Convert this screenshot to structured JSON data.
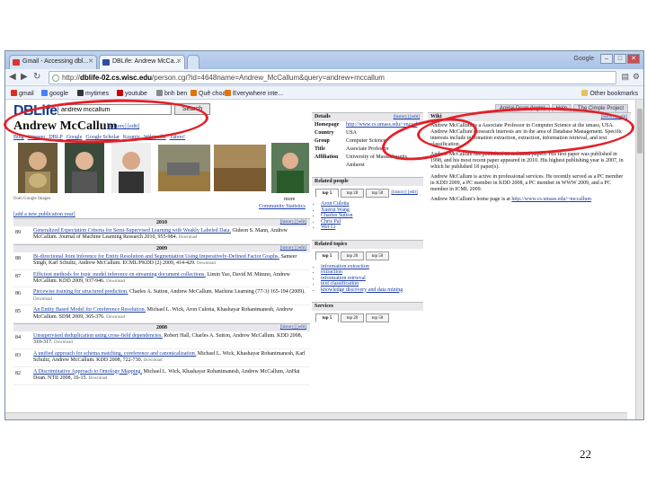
{
  "browser": {
    "tabs": [
      {
        "label": "Gmail - Accessing dbl...",
        "active": false
      },
      {
        "label": "DBLife: Andrew McCa...",
        "active": true
      }
    ],
    "window_label": "Google",
    "url_prefix": "http://",
    "url_host": "dblife-02.cs.wisc.edu",
    "url_rest": "/person.cgi?id=4648name=Andrew_McCallum&query=andrew+mccallum",
    "bookmarks": [
      {
        "label": "gmail",
        "color": "#d93025"
      },
      {
        "label": "google",
        "color": "#4285f4"
      },
      {
        "label": "mytimes",
        "color": "#333333"
      },
      {
        "label": "youtube",
        "color": "#cc0000"
      },
      {
        "label": "bnh ben",
        "color": "#666666"
      },
      {
        "label": "Quê choa",
        "color": "#e37400"
      },
      {
        "label": "Everywhere inte...",
        "color": "#e37400"
      }
    ],
    "other_bookmarks": "Other bookmarks"
  },
  "page": {
    "logo": "DBLife",
    "search_value": "andrew mccallum",
    "search_button": "Search",
    "top_links": [
      "AnHai Doan (login)",
      "Help",
      "The Cimple Project"
    ],
    "person_name": "Andrew McCallum",
    "history": "[history]",
    "edit": "[edit]",
    "search_links": [
      "Bing",
      "Citeseer",
      "DBLP",
      "Google",
      "Google Scholar",
      "Kosmix",
      "Wikipedia",
      "Yahoo!"
    ],
    "photos_caption": "from Google Images",
    "more": "more",
    "community_stats": "Community Statistics",
    "add_publication": "[add a new publication year]",
    "publications": [
      {
        "year": "2010",
        "items": [
          {
            "rank": "89",
            "title": "Generalized Expectation Criteria for Semi-Supervised Learning with Weakly Labeled Data.",
            "rest": "Gideon S. Mann, Andrew McCallum. Journal of Machine Learning Research 2010, 955-984.",
            "dl": "Download"
          }
        ]
      },
      {
        "year": "2009",
        "items": [
          {
            "rank": "88",
            "title": "Bi-directional Joint Inference for Entity Resolution and Segmentation Using Imperatively-Defined Factor Graphs.",
            "rest": "Sameer Singh, Karl Schultz, Andrew McCallum. ECML/PKDD (2) 2009, 414-429.",
            "dl": "Download"
          },
          {
            "rank": "87",
            "title": "Efficient methods for topic model inference on streaming document collections.",
            "rest": "Limin Yao, David M. Mimno, Andrew McCallum. KDD 2009, 937-946.",
            "dl": "Download"
          },
          {
            "rank": "86",
            "title": "Piecewise training for structured prediction.",
            "rest": "Charles A. Sutton, Andrew McCallum. Machine Learning (77-3) 165-194 (2009).",
            "dl": "Download"
          },
          {
            "rank": "85",
            "title": "An Entity Based Model for Coreference Resolution.",
            "rest": "Michael L. Wick, Aron Culotta, Khashayar Rohanimanesh, Andrew McCallum. SDM 2009, 365-376.",
            "dl": "Download"
          }
        ]
      },
      {
        "year": "2008",
        "items": [
          {
            "rank": "84",
            "title": "Unsupervised deduplication using cross-field dependencies.",
            "rest": "Robert Hall, Charles A. Sutton, Andrew McCallum. KDD 2008, 310-317.",
            "dl": "Download"
          },
          {
            "rank": "83",
            "title": "A unified approach for schema matching, coreference and canonicalization.",
            "rest": "Michael L. Wick, Khashayar Rohanimanesh, Karl Schultz, Andrew McCallum. KDD 2008, 722-730.",
            "dl": "Download"
          },
          {
            "rank": "82",
            "title": "A Discriminative Approach to Ontology Mapping.",
            "rest": "Michael L. Wick, Khashayar Rohanimanesh, Andrew McCallum, AnHai Doan. NTII 2008, 16-15.",
            "dl": "Download"
          }
        ]
      }
    ],
    "details": {
      "header": "Details",
      "rows": [
        {
          "k": "Homepage",
          "v": "http://www.cs.umass.edu/~mccal"
        },
        {
          "k": "Country",
          "v": "USA"
        },
        {
          "k": "Group",
          "v": "Computer Science"
        },
        {
          "k": "Title",
          "v": "Associate Professor"
        },
        {
          "k": "Affiliation",
          "v": "University of Massachusetts,"
        },
        {
          "k": "",
          "v": "Amherst"
        }
      ]
    },
    "related_people": {
      "header": "Related people",
      "tabs": [
        "top 5",
        "top 20",
        "top 50"
      ],
      "items": [
        "Aron Culotta",
        "Xuerui Wang",
        "Charles Sutton",
        "Chris Pal",
        "Wei Li"
      ]
    },
    "related_topics": {
      "header": "Related topics",
      "tabs": [
        "top 5",
        "top 20",
        "top 50"
      ],
      "items": [
        "information extraction",
        "extraction",
        "information retrieval",
        "text classification",
        "knowledge discovery and data mining"
      ]
    },
    "services": {
      "header": "Services",
      "tabs": [
        "top 5",
        "top 20",
        "top 50"
      ]
    },
    "wiki": {
      "header": "Wiki",
      "paragraphs": [
        "Andrew McCallum is a Associate Professor in Computer Science at the umass, USA. Andrew McCallum's research interests are in the area of Database Management. Specific interests include information extraction, extraction, information retrieval, and text classification.",
        "Andrew McCallum has published 89 technical papers. His first paper was published in 1998, and his most recent paper appeared in 2010. His highest publishing year is 2007, in which he published 18 paper(s).",
        "Andrew McCallum is active in professional services. He recently served as a PC member in KDD 2009, a PC member in KDD 2008, a PC member in WWW 2009, and a PC member in ICML 2009."
      ],
      "homepage_prefix": "Andrew McCallum's home page is at",
      "homepage_link": "http://www.cs.umass.edu/~mccallum"
    }
  },
  "slide_number": "22",
  "annotation_color": "#e32028"
}
